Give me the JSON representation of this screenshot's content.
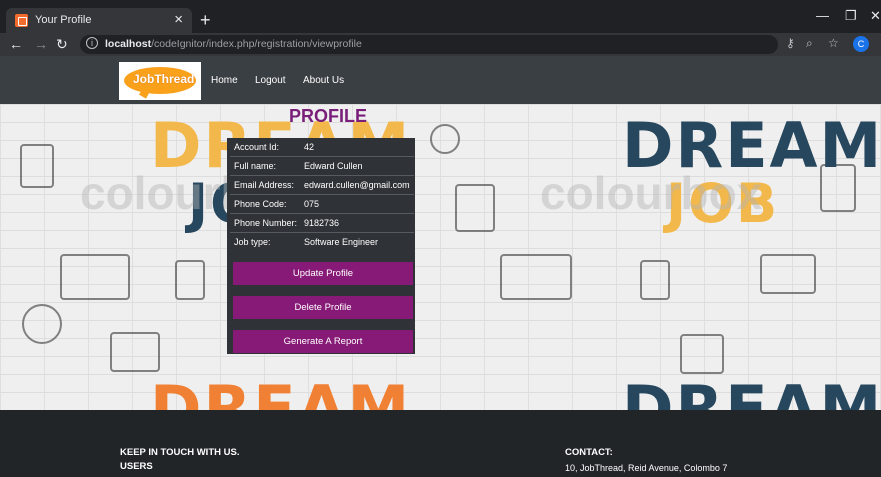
{
  "browser": {
    "tab_title": "Your Profile",
    "tab_close": "×",
    "new_tab": "+",
    "url_host": "localhost",
    "url_path": "/codeIgnitor/index.php/registration/viewprofile",
    "profile_initial": "C"
  },
  "site": {
    "logo_text": "JobThread",
    "nav": [
      "Home",
      "Logout",
      "About Us"
    ]
  },
  "hero": {
    "word1": "DREAM",
    "word2": "JOB",
    "watermark": "colourbox"
  },
  "profile": {
    "title": "PROFILE",
    "fields": [
      {
        "label": "Account Id:",
        "value": "42"
      },
      {
        "label": "Full name:",
        "value": "Edward Cullen"
      },
      {
        "label": "Email Address:",
        "value": "edward.cullen@gmail.com"
      },
      {
        "label": "Phone Code:",
        "value": "075"
      },
      {
        "label": "Phone Number:",
        "value": "9182736"
      },
      {
        "label": "Job type:",
        "value": "Software Engineer"
      }
    ],
    "buttons": [
      "Update Profile",
      "Delete Profile",
      "Generate A Report"
    ]
  },
  "footer": {
    "left_heading": "KEEP IN TOUCH WITH US.",
    "left_sub": "USERS",
    "right_heading": "CONTACT:",
    "right_text": "10, JobThread, Reid Avenue, Colombo 7"
  },
  "colors": {
    "accent": "#861a76",
    "title": "#7a1f79",
    "nav_bg": "#3a3f44",
    "card_bg": "#2f3337"
  }
}
